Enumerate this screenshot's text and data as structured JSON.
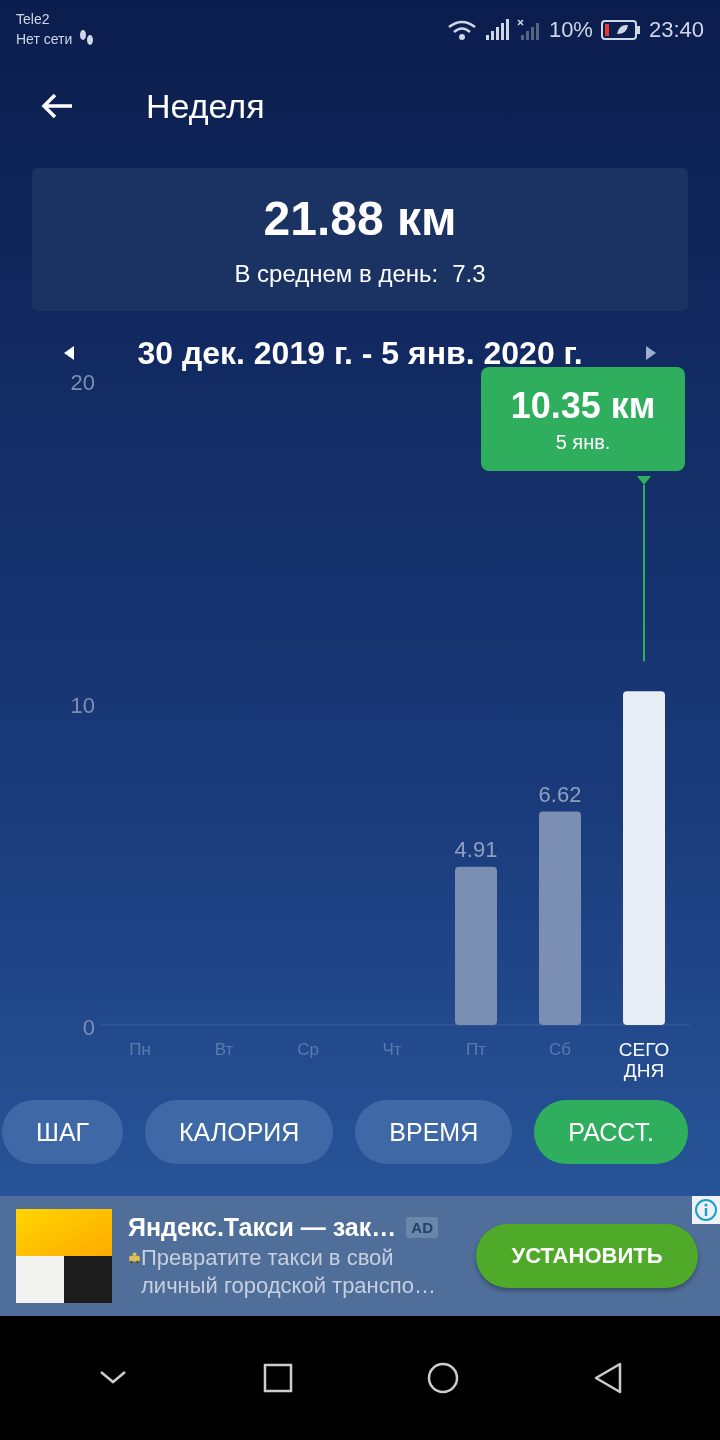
{
  "status_bar": {
    "carrier": "Tele2",
    "network": "Нет сети",
    "battery": "10%",
    "time": "23:40"
  },
  "header": {
    "title": "Неделя"
  },
  "summary": {
    "total": "21.88 км",
    "average_label": "В среднем в день:",
    "average_value": "7.3"
  },
  "period": {
    "label": "30 дек. 2019 г. - 5 янв. 2020 г."
  },
  "chart": {
    "highlighted": [
      false,
      false,
      false,
      false,
      false,
      false,
      true
    ],
    "tooltip": {
      "value": "10.35 км",
      "date": "5 янв."
    },
    "chart_data": {
      "type": "bar",
      "categories": [
        "Пн",
        "Вт",
        "Ср",
        "Чт",
        "Пт",
        "Сб",
        "СЕГОДНЯ"
      ],
      "values": [
        0,
        0,
        0,
        0,
        4.91,
        6.62,
        10.35
      ],
      "ylim": [
        0,
        20
      ],
      "yticks": [
        0,
        10,
        20
      ],
      "value_labels": [
        null,
        null,
        null,
        null,
        "4.91",
        "6.62",
        null
      ]
    }
  },
  "metrics": [
    {
      "label": "ШАГ",
      "selected": false
    },
    {
      "label": "КАЛОРИЯ",
      "selected": false
    },
    {
      "label": "ВРЕМЯ",
      "selected": false
    },
    {
      "label": "РАССТ.",
      "selected": true
    }
  ],
  "ad": {
    "title": "Яндекс.Такси — зак…",
    "badge": "AD",
    "text": "Превратите такси в свой личный городской транспо…",
    "button": "УСТАНОВИТЬ"
  }
}
